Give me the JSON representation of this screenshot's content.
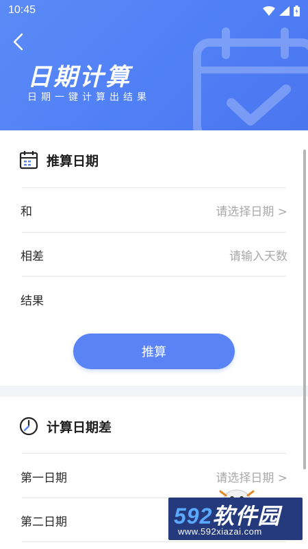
{
  "status": {
    "time": "10:45"
  },
  "header": {
    "title": "日期计算",
    "subtitle": "日期一键计算出结果"
  },
  "calc_date": {
    "title": "推算日期",
    "rows": [
      {
        "label": "和",
        "value": "请选择日期 >"
      },
      {
        "label": "相差",
        "value": "请输入天数"
      },
      {
        "label": "结果",
        "value": ""
      }
    ],
    "button": "推算"
  },
  "date_diff": {
    "title": "计算日期差",
    "rows": [
      {
        "label": "第一日期",
        "value": "请选择日期 >"
      },
      {
        "label": "第二日期",
        "value": ""
      }
    ]
  },
  "watermark": {
    "brand_num": "592",
    "brand_cn": "软件园",
    "url": "www.592xiazai.com"
  },
  "colors": {
    "primary": "#5a84f5",
    "header": "#4f7ef5"
  }
}
